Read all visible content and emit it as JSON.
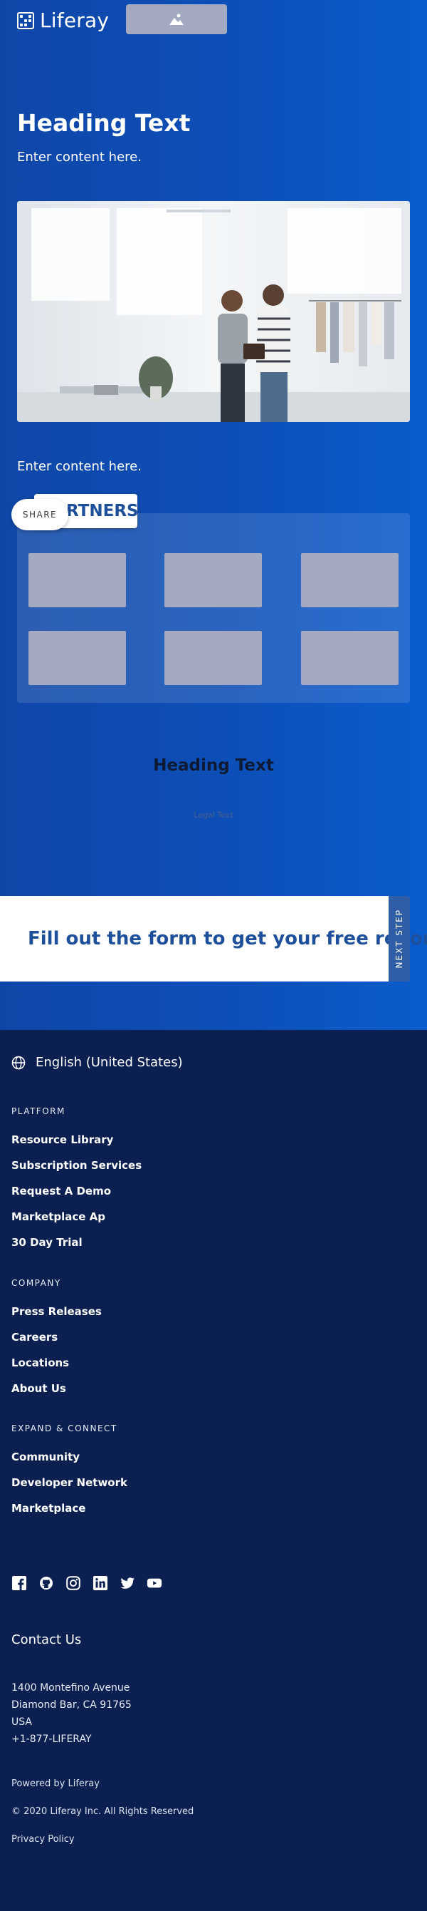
{
  "header": {
    "logo_text": "Liferay",
    "logo_icon": "liferay-logo-icon",
    "image_placeholder_icon": "image-icon"
  },
  "hero": {
    "heading": "Heading Text",
    "lead": "Enter content here.",
    "photo_alt": "Two people looking at a tablet in a clothing store",
    "secondary_text": "Enter content here."
  },
  "partners": {
    "tab_label": "PARTNERS",
    "tab_visible_text": "RTNERS",
    "share_label": "SHARE",
    "logo_count": 6
  },
  "section2": {
    "heading": "Heading Text",
    "legal_text": "Legal Text"
  },
  "cta": {
    "text": "Fill out the form to get your free report",
    "next_step_label": "NEXT STEP"
  },
  "footer": {
    "language": "English (United States)",
    "language_icon": "globe-icon",
    "platform": {
      "title": "PLATFORM",
      "links": [
        "Resource Library",
        "Subscription Services",
        "Request A Demo",
        "Marketplace Ap",
        "30 Day Trial"
      ]
    },
    "company": {
      "title": "COMPANY",
      "links": [
        "Press Releases",
        "Careers",
        "Locations",
        "About Us"
      ]
    },
    "expand": {
      "title": "EXPAND & CONNECT",
      "links": [
        "Community",
        "Developer Network",
        "Marketplace"
      ]
    },
    "social_icons": [
      "facebook-icon",
      "github-icon",
      "instagram-icon",
      "linkedin-icon",
      "twitter-icon",
      "youtube-icon"
    ],
    "contact_title": "Contact Us",
    "address_lines": [
      "1400 Montefino Avenue",
      "Diamond Bar, CA 91765",
      "USA",
      "+1-877-LIFERAY"
    ],
    "powered_by": "Powered by Liferay",
    "copyright": "© 2020 Liferay Inc. All Rights Reserved",
    "privacy": "Privacy Policy"
  },
  "colors": {
    "hero_blue": "#0d4fb8",
    "footer_navy": "#0b2050",
    "brand_text_blue": "#1d4f9b",
    "placeholder_gray": "#a3a9c1"
  }
}
